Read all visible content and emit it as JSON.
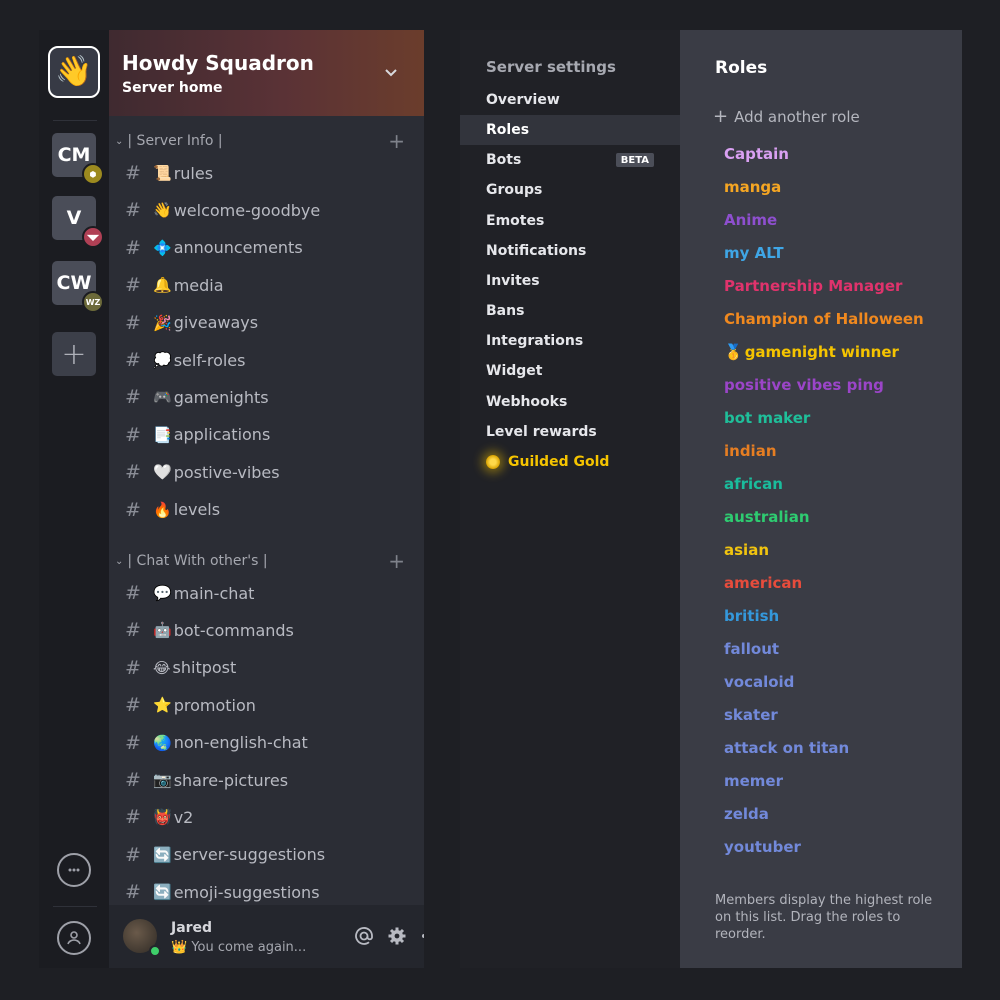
{
  "server": {
    "name": "Howdy Squadron",
    "subtitle": "Server home"
  },
  "rail": {
    "servers": [
      {
        "label": "CM",
        "badge": "⬢",
        "badge_color": "#9c8a1f"
      },
      {
        "label": "V",
        "badge": "◥◤",
        "badge_color": "#b04055"
      },
      {
        "label": "CW",
        "badge": "WZ",
        "badge_color": "#6c6a3a"
      }
    ]
  },
  "categories": [
    {
      "label": "| Server Info |",
      "channels": [
        {
          "emoji": "📜",
          "name": "rules"
        },
        {
          "emoji": "👋",
          "name": "welcome-goodbye"
        },
        {
          "emoji": "💠",
          "name": "announcements"
        },
        {
          "emoji": "🔔",
          "name": "media"
        },
        {
          "emoji": "🎉",
          "name": "giveaways"
        },
        {
          "emoji": "💭",
          "name": "self-roles"
        },
        {
          "emoji": "🎮",
          "name": "gamenights"
        },
        {
          "emoji": "📑",
          "name": "applications"
        },
        {
          "emoji": "🤍",
          "name": "postive-vibes"
        },
        {
          "emoji": "🔥",
          "name": "levels"
        }
      ]
    },
    {
      "label": "| Chat With other's |",
      "channels": [
        {
          "emoji": "💬",
          "name": "main-chat"
        },
        {
          "emoji": "🤖",
          "name": "bot-commands"
        },
        {
          "emoji": "😂",
          "name": "shitpost"
        },
        {
          "emoji": "⭐",
          "name": "promotion"
        },
        {
          "emoji": "🌏",
          "name": "non-english-chat"
        },
        {
          "emoji": "📷",
          "name": "share-pictures"
        },
        {
          "emoji": "👹",
          "name": "v2"
        },
        {
          "emoji": "🔄",
          "name": "server-suggestions"
        },
        {
          "emoji": "🔄",
          "name": "emoji-suggestions"
        }
      ]
    }
  ],
  "user": {
    "name": "Jared",
    "status_emoji": "👑",
    "status": "You come again..."
  },
  "settings": {
    "title": "Server settings",
    "items": [
      {
        "label": "Overview"
      },
      {
        "label": "Roles",
        "active": true
      },
      {
        "label": "Bots",
        "badge": "BETA"
      },
      {
        "label": "Groups"
      },
      {
        "label": "Emotes"
      },
      {
        "label": "Notifications"
      },
      {
        "label": "Invites"
      },
      {
        "label": "Bans"
      },
      {
        "label": "Integrations"
      },
      {
        "label": "Widget"
      },
      {
        "label": "Webhooks"
      },
      {
        "label": "Level rewards"
      },
      {
        "label": "Guilded Gold",
        "gold": true
      }
    ]
  },
  "roles": {
    "title": "Roles",
    "add_label": "Add another role",
    "footer": "Members display the highest role on this list. Drag the roles to reorder.",
    "items": [
      {
        "name": "Captain",
        "color": "#d9a0f2"
      },
      {
        "name": "manga",
        "color": "#f5a623"
      },
      {
        "name": "Anime",
        "color": "#8e4fcf"
      },
      {
        "name": "my ALT",
        "color": "#3fa6e6"
      },
      {
        "name": "Partnership Manager",
        "color": "#e0336c"
      },
      {
        "name": "Champion of Halloween",
        "color": "#f0891f"
      },
      {
        "name": "gamenight winner",
        "color": "#f5c400",
        "emoji": "🥇"
      },
      {
        "name": "positive vibes ping",
        "color": "#9b45c8"
      },
      {
        "name": "bot maker",
        "color": "#1fbf9a"
      },
      {
        "name": "indian",
        "color": "#e67e22"
      },
      {
        "name": "african",
        "color": "#1abc9c"
      },
      {
        "name": "australian",
        "color": "#2ecc71"
      },
      {
        "name": "asian",
        "color": "#f1c40f"
      },
      {
        "name": "american",
        "color": "#e74c3c"
      },
      {
        "name": "british",
        "color": "#3498db"
      },
      {
        "name": "fallout",
        "color": "#7289da"
      },
      {
        "name": "vocaloid",
        "color": "#7289da"
      },
      {
        "name": "skater",
        "color": "#7289da"
      },
      {
        "name": "attack on titan",
        "color": "#7289da"
      },
      {
        "name": "memer",
        "color": "#7289da"
      },
      {
        "name": "zelda",
        "color": "#7289da"
      },
      {
        "name": "youtuber",
        "color": "#7289da"
      }
    ]
  }
}
